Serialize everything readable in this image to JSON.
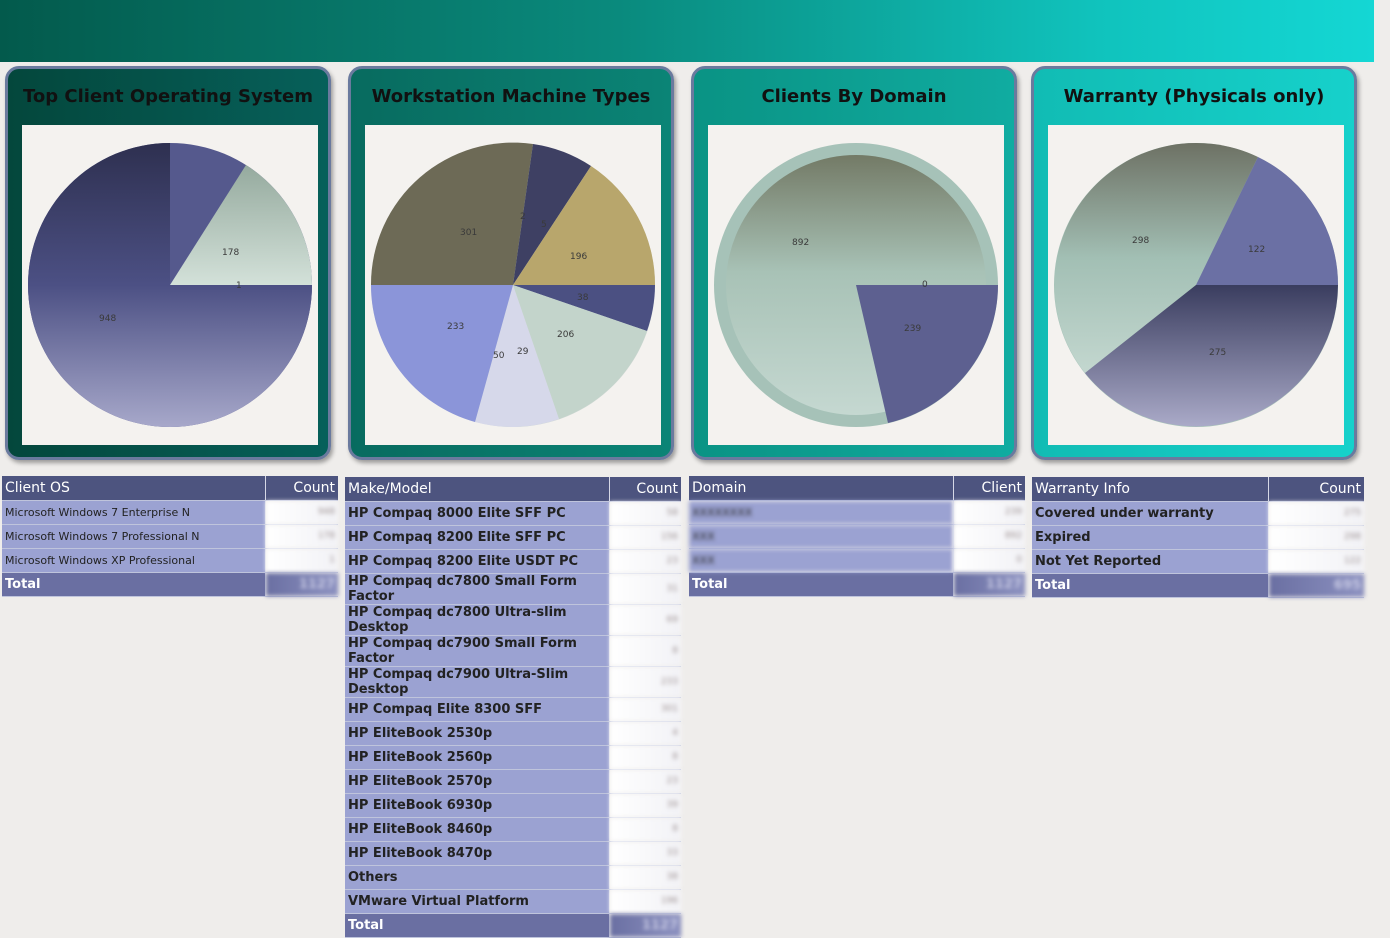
{
  "colors": {
    "banner_start": "#035a4c",
    "banner_end": "#14d7d4",
    "table_header": "#4d547f",
    "table_row": "#9ba2d2",
    "table_total": "#6a6fa2"
  },
  "cards": [
    {
      "title": "Top Client Operating System",
      "labels": [
        "178",
        "1",
        "948"
      ]
    },
    {
      "title": "Workstation Machine Types",
      "labels": [
        "301",
        "196",
        "38",
        "206",
        "233",
        "50",
        "29",
        "2",
        "5"
      ]
    },
    {
      "title": "Clients By Domain",
      "labels": [
        "892",
        "0",
        "239"
      ]
    },
    {
      "title": "Warranty (Physicals only)",
      "labels": [
        "298",
        "122",
        "275"
      ]
    }
  ],
  "tables": {
    "client_os": {
      "header": "Client OS",
      "count_header": "Count",
      "rows": [
        {
          "label": "Microsoft Windows 7 Enterprise N",
          "value": "948"
        },
        {
          "label": "Microsoft Windows 7 Professional N",
          "value": "178"
        },
        {
          "label": "Microsoft Windows XP Professional",
          "value": "1"
        }
      ],
      "total_label": "Total",
      "total_value": "1127"
    },
    "make_model": {
      "header": "Make/Model",
      "count_header": "Count",
      "rows": [
        {
          "label": "HP Compaq 8000 Elite SFF PC",
          "value": "58"
        },
        {
          "label": "HP Compaq 8200 Elite SFF PC",
          "value": "156"
        },
        {
          "label": "HP Compaq 8200 Elite USDT PC",
          "value": "23"
        },
        {
          "label": "HP Compaq dc7800 Small Form Factor",
          "value": "31"
        },
        {
          "label": "HP Compaq dc7800 Ultra-slim Desktop",
          "value": "69"
        },
        {
          "label": "HP Compaq dc7900 Small Form Factor",
          "value": "8"
        },
        {
          "label": "HP Compaq dc7900 Ultra-Slim Desktop",
          "value": "233"
        },
        {
          "label": "HP Compaq Elite 8300 SFF",
          "value": "301"
        },
        {
          "label": "HP EliteBook 2530p",
          "value": "4"
        },
        {
          "label": "HP EliteBook 2560p",
          "value": "8"
        },
        {
          "label": "HP EliteBook 2570p",
          "value": "23"
        },
        {
          "label": "HP EliteBook 6930p",
          "value": "39"
        },
        {
          "label": "HP EliteBook 8460p",
          "value": "8"
        },
        {
          "label": "HP EliteBook 8470p",
          "value": "33"
        },
        {
          "label": "Others",
          "value": "38"
        },
        {
          "label": "VMware Virtual Platform",
          "value": "196"
        }
      ],
      "total_label": "Total",
      "total_value": "1127"
    },
    "domain": {
      "header": "Domain",
      "count_header": "Client",
      "rows": [
        {
          "label": "XXXXXXXX",
          "value": "239"
        },
        {
          "label": "XXX",
          "value": "892"
        },
        {
          "label": "XXX",
          "value": "0"
        }
      ],
      "total_label": "Total",
      "total_value": "1127"
    },
    "warranty": {
      "header": "Warranty Info",
      "count_header": "Count",
      "rows": [
        {
          "label": "Covered under warranty",
          "value": "275"
        },
        {
          "label": "Expired",
          "value": "298"
        },
        {
          "label": "Not Yet Reported",
          "value": "122"
        }
      ],
      "total_label": "Total",
      "total_value": "695"
    }
  }
}
